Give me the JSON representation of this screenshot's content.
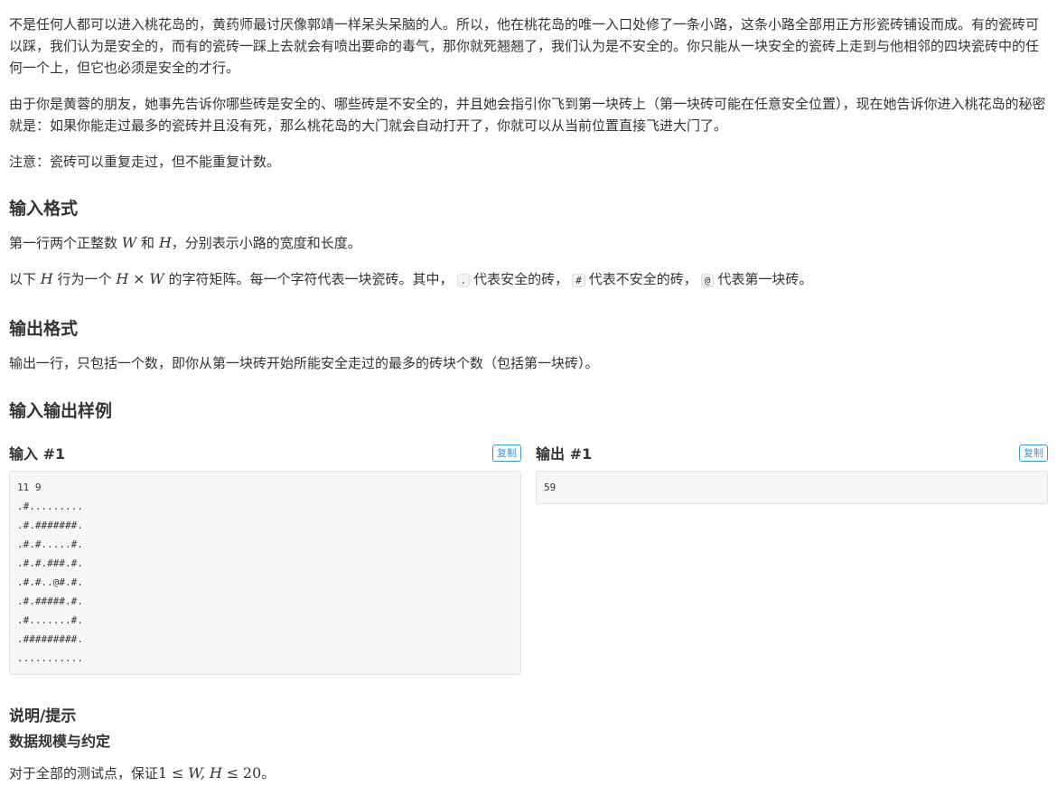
{
  "description": {
    "para1": "不是任何人都可以进入桃花岛的，黄药师最讨厌像郭靖一样呆头呆脑的人。所以，他在桃花岛的唯一入口处修了一条小路，这条小路全部用正方形瓷砖铺设而成。有的瓷砖可以踩，我们认为是安全的，而有的瓷砖一踩上去就会有喷出要命的毒气，那你就死翘翘了，我们认为是不安全的。你只能从一块安全的瓷砖上走到与他相邻的四块瓷砖中的任何一个上，但它也必须是安全的才行。",
    "para2": "由于你是黄蓉的朋友，她事先告诉你哪些砖是安全的、哪些砖是不安全的，并且她会指引你飞到第一块砖上（第一块砖可能在任意安全位置），现在她告诉你进入桃花岛的秘密就是：如果你能走过最多的瓷砖并且没有死，那么桃花岛的大门就会自动打开了，你就可以从当前位置直接飞进大门了。",
    "para3": "注意：瓷砖可以重复走过，但不能重复计数。"
  },
  "input_format": {
    "heading": "输入格式",
    "line1_a": "第一行两个正整数",
    "var_w": "W",
    "line1_and": "和",
    "var_h": "H",
    "line1_b": "，分别表示小路的宽度和长度。",
    "line2_a": "以下",
    "line2_b": "行为一个",
    "times": "×",
    "line2_c": "的字符矩阵。每一个字符代表一块瓷砖。其中，",
    "code_safe": ".",
    "line2_d": "代表安全的砖，",
    "code_unsafe": "#",
    "line2_e": "代表不安全的砖，",
    "code_start": "@",
    "line2_f": "代表第一块砖。"
  },
  "output_format": {
    "heading": "输出格式",
    "text": "输出一行，只包括一个数，即你从第一块砖开始所能安全走过的最多的砖块个数（包括第一块砖）。"
  },
  "samples": {
    "heading": "输入输出样例",
    "input_title": "输入 #1",
    "output_title": "输出 #1",
    "copy_label": "复制",
    "input_text": "11 9\n.#.........\n.#.#######.\n.#.#.....#.\n.#.#.###.#.\n.#.#..@#.#.\n.#.#####.#.\n.#.......#.\n.#########.\n...........",
    "output_text": "59"
  },
  "hint": {
    "heading": "说明/提示",
    "subheading": "数据规模与约定",
    "text_a": "对于全部的测试点，保证",
    "math_one": "1",
    "le1": "≤",
    "wh": "W, H",
    "le2": "≤",
    "twenty": "20",
    "text_b": "。"
  }
}
